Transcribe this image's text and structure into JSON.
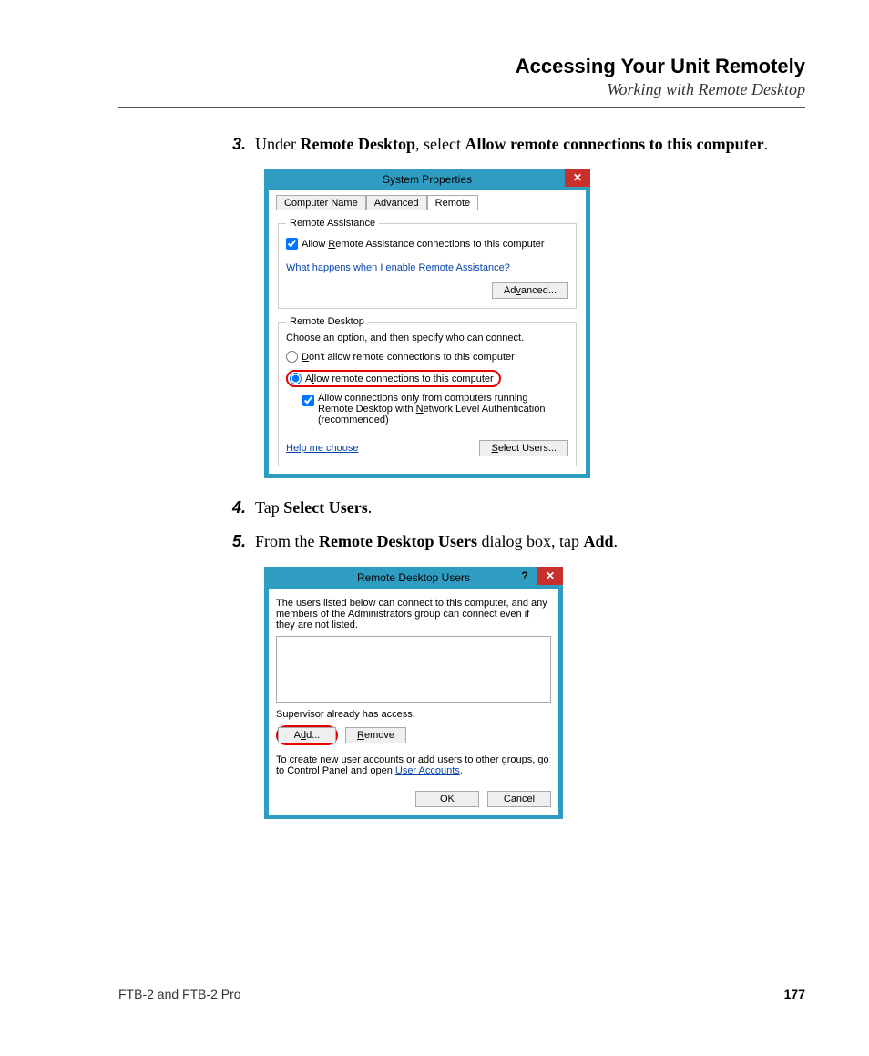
{
  "header": {
    "title": "Accessing Your Unit Remotely",
    "subtitle": "Working with Remote Desktop"
  },
  "steps": {
    "s3": {
      "num": "3.",
      "pre": "Under ",
      "b1": "Remote Desktop",
      "mid": ", select ",
      "b2": "Allow remote connections to this computer",
      "post": "."
    },
    "s4": {
      "num": "4.",
      "pre": "Tap ",
      "b1": "Select Users",
      "post": "."
    },
    "s5": {
      "num": "5.",
      "pre": "From the ",
      "b1": "Remote Desktop Users",
      "mid": " dialog box, tap ",
      "b2": "Add",
      "post": "."
    }
  },
  "dlg1": {
    "title": "System Properties",
    "tabs": {
      "t1": "Computer Name",
      "t2": "Advanced",
      "t3": "Remote"
    },
    "group1": {
      "legend": "Remote Assistance",
      "chk_pre": "Allow ",
      "chk_u": "R",
      "chk_post": "emote Assistance connections to this computer",
      "link": "What happens when I enable Remote Assistance?",
      "btn_pre": "Ad",
      "btn_u": "v",
      "btn_post": "anced..."
    },
    "group2": {
      "legend": "Remote Desktop",
      "intro": "Choose an option, and then specify who can connect.",
      "r1_u": "D",
      "r1_post": "on't allow remote connections to this computer",
      "r2_pre": "A",
      "r2_u": "l",
      "r2_post": "low remote connections to this computer",
      "chk2_pre": "Allow connections only from computers running Remote Desktop with ",
      "chk2_u": "N",
      "chk2_post": "etwork Level Authentication (recommended)",
      "help": "Help me choose",
      "btn2_u": "S",
      "btn2_post": "elect Users..."
    }
  },
  "dlg2": {
    "title": "Remote Desktop Users",
    "help": "?",
    "intro": "The users listed below can connect to this computer, and any members of the Administrators group can connect even if they are not listed.",
    "access": "Supervisor already has access.",
    "add_pre": "A",
    "add_u": "d",
    "add_post": "d...",
    "remove_u": "R",
    "remove_post": "emove",
    "note_pre": "To create new user accounts or add users to other groups, go to Control Panel and open ",
    "note_link": "User Accounts",
    "note_post": ".",
    "ok": "OK",
    "cancel": "Cancel"
  },
  "footer": {
    "product": "FTB-2 and FTB-2 Pro",
    "page": "177"
  }
}
